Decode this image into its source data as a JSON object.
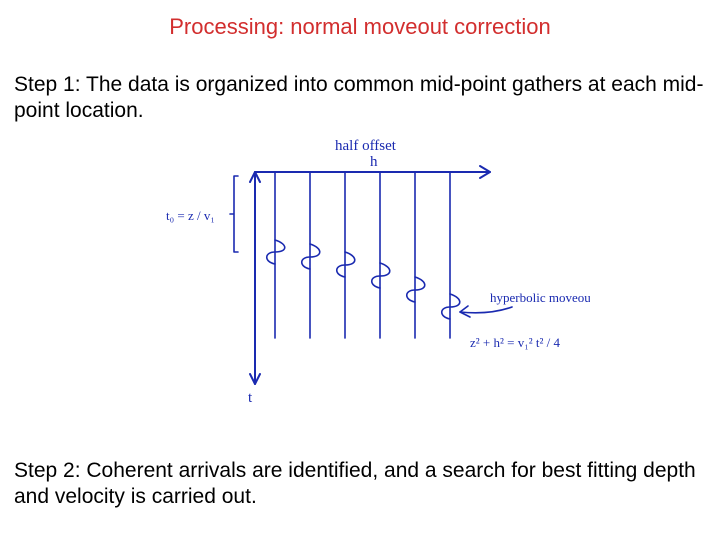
{
  "title": "Processing: normal moveout correction",
  "step1": "Step 1: The data is organized into common mid-point gathers at each mid-point location.",
  "step2": "Step 2: Coherent arrivals are identified, and a search for best fitting depth and velocity is carried out.",
  "fig": {
    "xlabel_top": "half offset",
    "xvar": "h",
    "yvar": "t",
    "t0_label": "t₀ = z / v₁",
    "moveout_label": "hyperbolic moveout",
    "equation": "z² + h² = v₁² t² / 4"
  }
}
